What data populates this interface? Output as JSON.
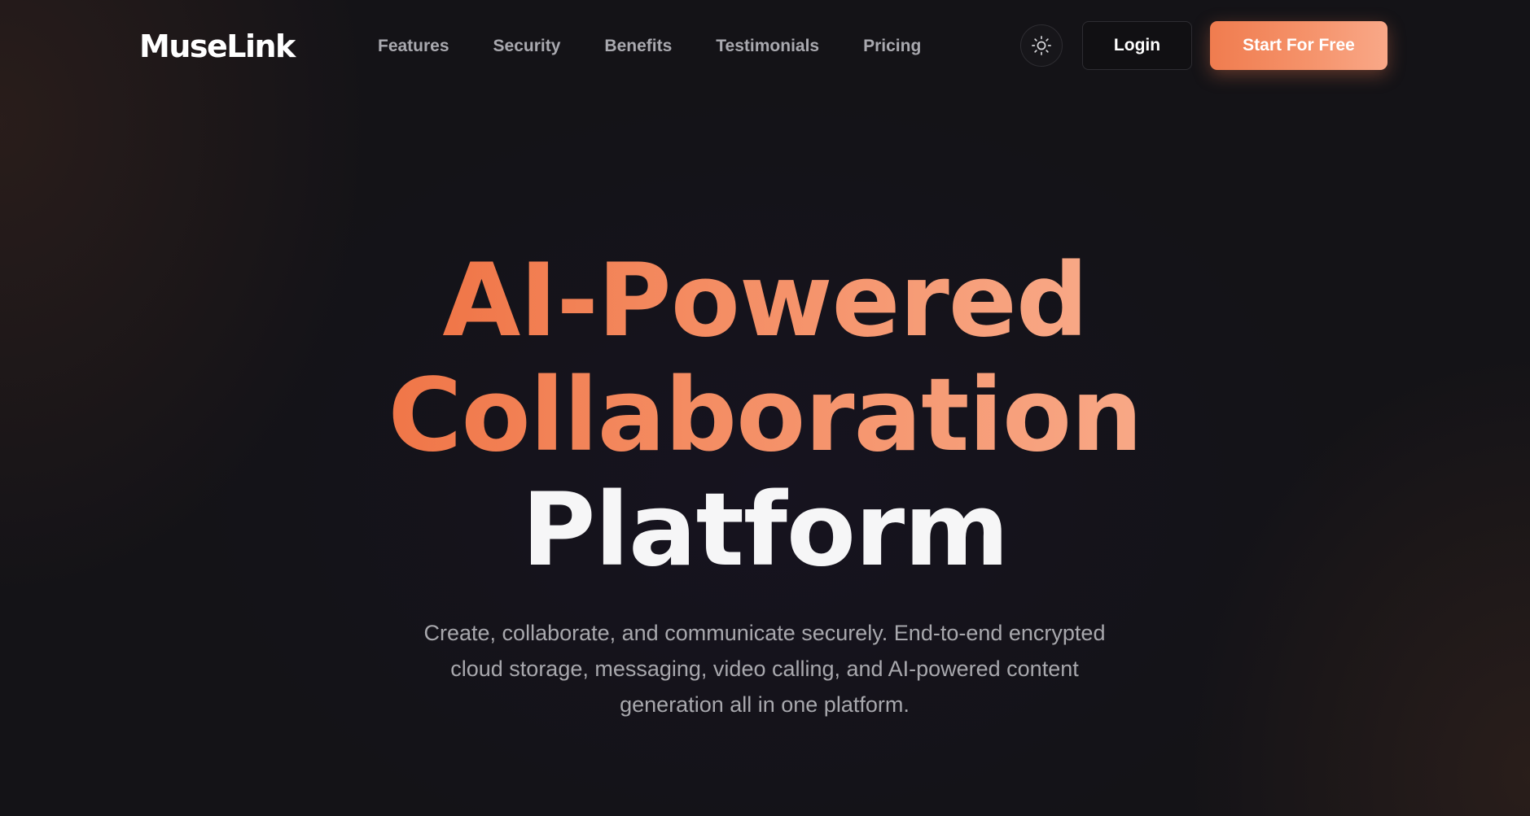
{
  "brand": {
    "name": "MuseLink"
  },
  "nav": {
    "links": [
      {
        "label": "Features"
      },
      {
        "label": "Security"
      },
      {
        "label": "Benefits"
      },
      {
        "label": "Testimonials"
      },
      {
        "label": "Pricing"
      }
    ],
    "theme_toggle_icon": "sun-icon",
    "login_label": "Login",
    "cta_label": "Start For Free"
  },
  "hero": {
    "title_line_1": "AI-Powered",
    "title_line_2": "Collaboration",
    "title_line_3": "Platform",
    "subtitle": "Create, collaborate, and communicate securely. End-to-end encrypted cloud storage, messaging, video calling, and AI-powered content generation all in one platform."
  },
  "colors": {
    "background": "#141317",
    "accent_start": "#f07648",
    "accent_end": "#f8a886",
    "text_primary": "#ffffff",
    "text_muted": "#a8a8ad"
  }
}
